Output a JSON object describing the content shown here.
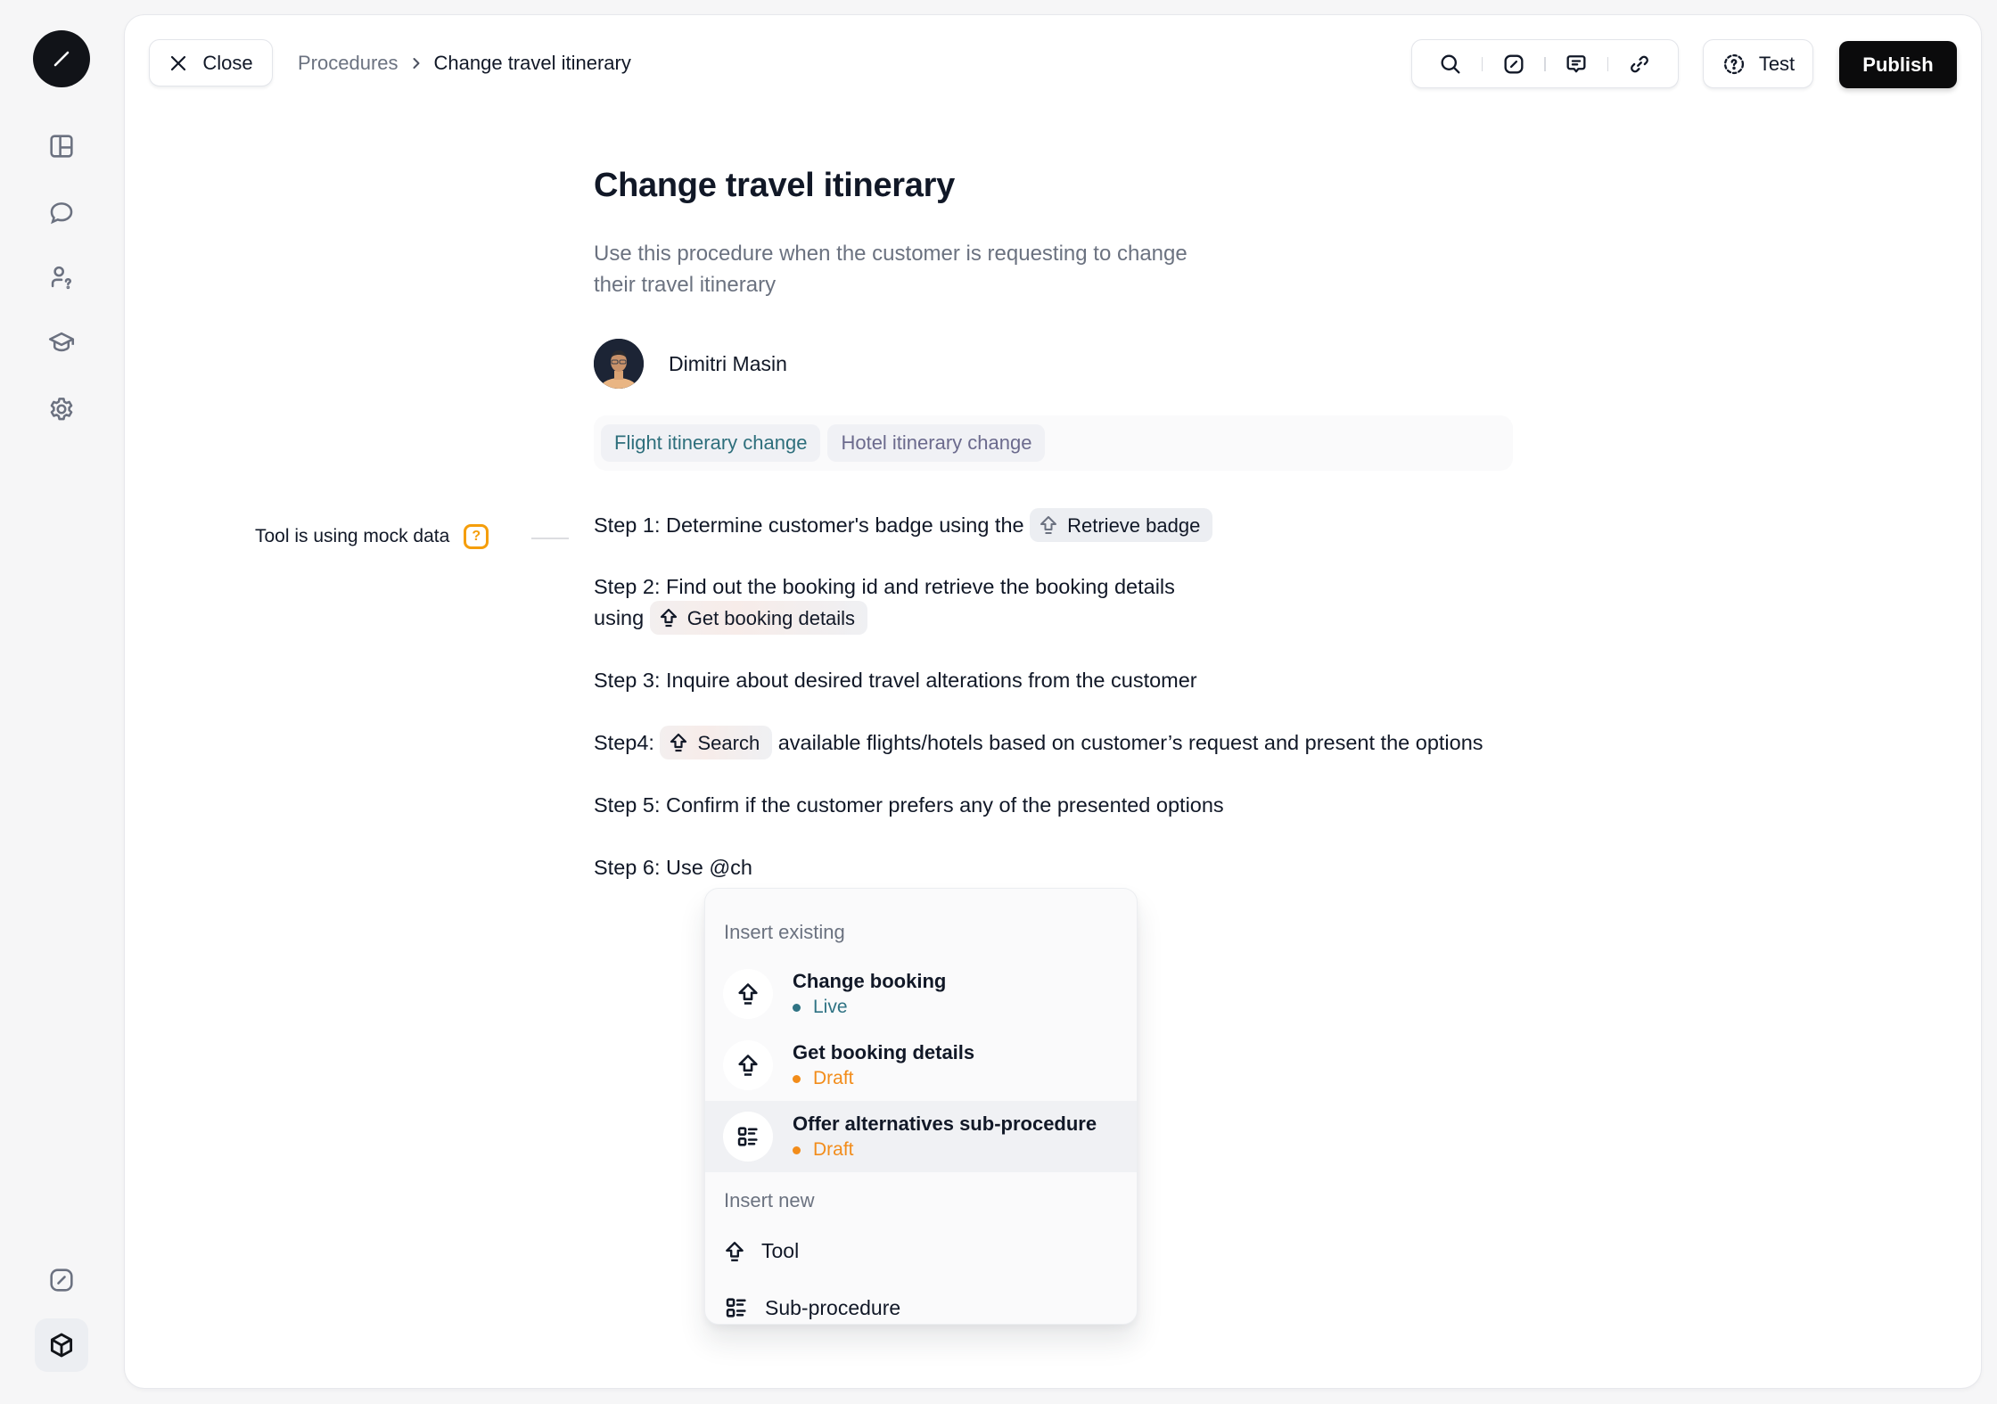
{
  "rail": {
    "logo": "slash-logo-icon",
    "items": [
      {
        "icon": "layout-grid-icon",
        "name": "rail-item-dashboard"
      },
      {
        "icon": "chat-bubble-icon",
        "name": "rail-item-conversations"
      },
      {
        "icon": "user-question-icon",
        "name": "rail-item-customers"
      },
      {
        "icon": "graduation-cap-icon",
        "name": "rail-item-training"
      },
      {
        "icon": "gear-icon",
        "name": "rail-item-settings"
      }
    ],
    "bottom_items": [
      {
        "icon": "slash-square-icon",
        "name": "rail-item-procedures"
      },
      {
        "icon": "cube-icon",
        "name": "rail-item-tools",
        "active": true
      }
    ]
  },
  "topbar": {
    "close_label": "Close",
    "breadcrumb": [
      "Procedures",
      "Change travel itinerary"
    ],
    "toolbar_icons": [
      "search-icon",
      "slash-square-icon",
      "comment-icon",
      "link-icon"
    ],
    "test_label": "Test",
    "publish_label": "Publish"
  },
  "procedure": {
    "title": "Change travel itinerary",
    "description": "Use this procedure when the customer is requesting to change their travel itinerary",
    "author": "Dimitri Masin",
    "tags": [
      "Flight itinerary change",
      "Hotel itinerary change"
    ],
    "mock_note": "Tool is using mock data",
    "steps": [
      {
        "before": "Step 1: Determine customer's badge using the ",
        "chip": "Retrieve badge",
        "after": ""
      },
      {
        "before": "Step 2: Find out the booking id and retrieve the booking details",
        "line2_before": "using ",
        "chip": "Get booking details",
        "after": ""
      },
      {
        "before": "Step 3: Inquire about desired travel alterations from the customer"
      },
      {
        "before": "Step4: ",
        "chip": "Search",
        "after": " available flights/hotels based on customer’s request and present the options"
      },
      {
        "before": "Step 5: Confirm if the customer prefers any of the presented options"
      },
      {
        "before": "Step 6: Use @ch"
      }
    ]
  },
  "menu": {
    "existing_heading": "Insert existing",
    "existing": [
      {
        "title": "Change booking",
        "status": "Live",
        "status_color": "#2f7384",
        "icon": "tool-arrow-icon"
      },
      {
        "title": "Get booking details",
        "status": "Draft",
        "status_color": "#f28c1a",
        "icon": "tool-arrow-icon"
      },
      {
        "title": "Offer alternatives sub-procedure",
        "status": "Draft",
        "status_color": "#f28c1a",
        "icon": "sub-procedure-icon"
      }
    ],
    "new_heading": "Insert new",
    "new": [
      {
        "label": "Tool",
        "icon": "tool-arrow-icon"
      },
      {
        "label": "Sub-procedure",
        "icon": "sub-procedure-icon"
      }
    ]
  },
  "colors": {
    "accent_dark": "#0b0b0c",
    "live": "#2f7384",
    "draft": "#f28c1a",
    "warning": "#f59e0b"
  }
}
